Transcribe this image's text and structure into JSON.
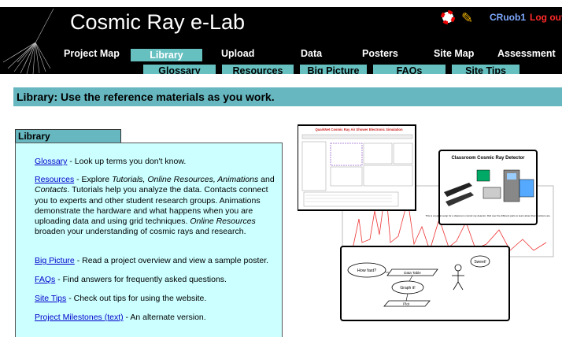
{
  "header": {
    "site_title": "Cosmic Ray e-Lab",
    "username": "CRuob1",
    "logout": "Log out",
    "icons": [
      "lifebuoy-icon",
      "pencil-icon"
    ]
  },
  "nav_primary": [
    {
      "label": "Project Map"
    },
    {
      "label": "Library",
      "active": true
    },
    {
      "label": "Upload"
    },
    {
      "label": "Data"
    },
    {
      "label": "Posters"
    },
    {
      "label": "Site Map"
    },
    {
      "label": "Assessment"
    }
  ],
  "nav_secondary": [
    {
      "label": "Glossary"
    },
    {
      "label": "Resources"
    },
    {
      "label": "Big Picture"
    },
    {
      "label": "FAQs"
    },
    {
      "label": "Site Tips"
    }
  ],
  "banner": "Library: Use the reference materials as you work.",
  "library": {
    "heading": "Library",
    "glossary": {
      "link": "Glossary",
      "text": " - Look up terms you don't know."
    },
    "resources": {
      "link": "Resources",
      "t1": " - Explore ",
      "i1": "Tutorials, Online Resources, Animations",
      "t2": " and ",
      "i2": "Contacts",
      "t3": ". Tutorials help you analyze the data. Contacts connect you to experts and other student research groups. Animations demonstrate the hardware and what happens when you are uploading data and using grid techniques. ",
      "i3": "Online Resources",
      "t4": " broaden your understanding of cosmic rays and research."
    },
    "bigpicture": {
      "link": "Big Picture",
      "text": " - Read a project overview and view a sample poster."
    },
    "faqs": {
      "link": "FAQs",
      "text": " - Find answers for frequently asked questions."
    },
    "sitetips": {
      "link": "Site Tips",
      "text": " - Check out tips for using the website."
    },
    "milestones": {
      "link": "Project Milestones (text)",
      "text": " - An alternate version."
    }
  },
  "collage": {
    "sim_title": "QuarkNet Cosmic Ray Air Shower Electronic Simulation",
    "detector_title": "Classroom Cosmic Ray Detector",
    "detector_caption": "This is a typical setup for a classroom cosmic ray detector. Roll over the different parts to learn about their functions are.",
    "flow": {
      "how_fast": "How fast?",
      "data_table": "Data Table",
      "graph_it": "Graph it!",
      "plot": "Plot",
      "sweet": "Sweet!"
    }
  }
}
